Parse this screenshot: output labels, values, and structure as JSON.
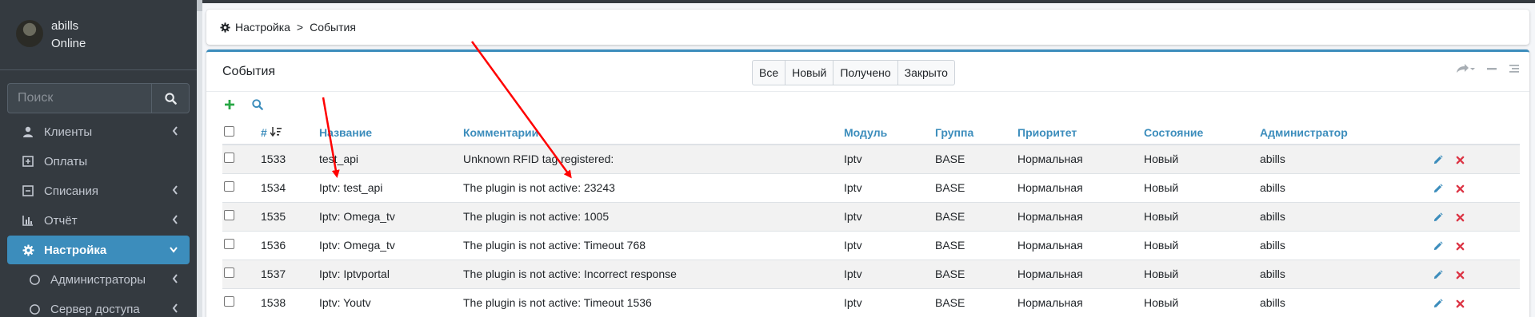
{
  "sidebar": {
    "user": {
      "name": "abills",
      "status": "Online"
    },
    "search": {
      "placeholder": "Поиск"
    },
    "items": [
      {
        "label": "Клиенты",
        "icon": "user-icon",
        "chevron": true
      },
      {
        "label": "Оплаты",
        "icon": "plus-square-icon",
        "chevron": false
      },
      {
        "label": "Списания",
        "icon": "minus-square-icon",
        "chevron": true
      },
      {
        "label": "Отчёт",
        "icon": "bar-chart-icon",
        "chevron": true
      },
      {
        "label": "Настройка",
        "icon": "gear-icon",
        "chevron": true,
        "active": true
      },
      {
        "label": "Администраторы",
        "icon": "circle-icon",
        "chevron": true
      },
      {
        "label": "Сервер доступа",
        "icon": "circle-icon",
        "chevron": true
      }
    ]
  },
  "breadcrumb": {
    "root": "Настройка",
    "separator": ">",
    "current": "События"
  },
  "card": {
    "title": "События",
    "filters": [
      "Все",
      "Новый",
      "Получено",
      "Закрыто"
    ]
  },
  "table": {
    "columns": [
      "#",
      "Название",
      "Комментарии",
      "Модуль",
      "Группа",
      "Приоритет",
      "Состояние",
      "Администратор"
    ],
    "rows": [
      {
        "id": "1533",
        "name": "test_api",
        "comment": "Unknown RFID tag registered:",
        "module": "Iptv",
        "group": "BASE",
        "priority": "Нормальная",
        "state": "Новый",
        "admin": "abills"
      },
      {
        "id": "1534",
        "name": "Iptv: test_api",
        "comment": "The plugin is not active: 23243",
        "module": "Iptv",
        "group": "BASE",
        "priority": "Нормальная",
        "state": "Новый",
        "admin": "abills"
      },
      {
        "id": "1535",
        "name": "Iptv: Omega_tv",
        "comment": "The plugin is not active: 1005",
        "module": "Iptv",
        "group": "BASE",
        "priority": "Нормальная",
        "state": "Новый",
        "admin": "abills"
      },
      {
        "id": "1536",
        "name": "Iptv: Omega_tv",
        "comment": "The plugin is not active: Timeout 768",
        "module": "Iptv",
        "group": "BASE",
        "priority": "Нормальная",
        "state": "Новый",
        "admin": "abills"
      },
      {
        "id": "1537",
        "name": "Iptv: Iptvportal",
        "comment": "The plugin is not active: Incorrect response",
        "module": "Iptv",
        "group": "BASE",
        "priority": "Нормальная",
        "state": "Новый",
        "admin": "abills"
      },
      {
        "id": "1538",
        "name": "Iptv: Youtv",
        "comment": "The plugin is not active: Timeout 1536",
        "module": "Iptv",
        "group": "BASE",
        "priority": "Нормальная",
        "state": "Новый",
        "admin": "abills"
      }
    ]
  },
  "colors": {
    "accent": "#3c8dbc",
    "sidebar": "#343a40",
    "add": "#28a745",
    "delete": "#dc3545",
    "annotation": "#ff0000"
  }
}
